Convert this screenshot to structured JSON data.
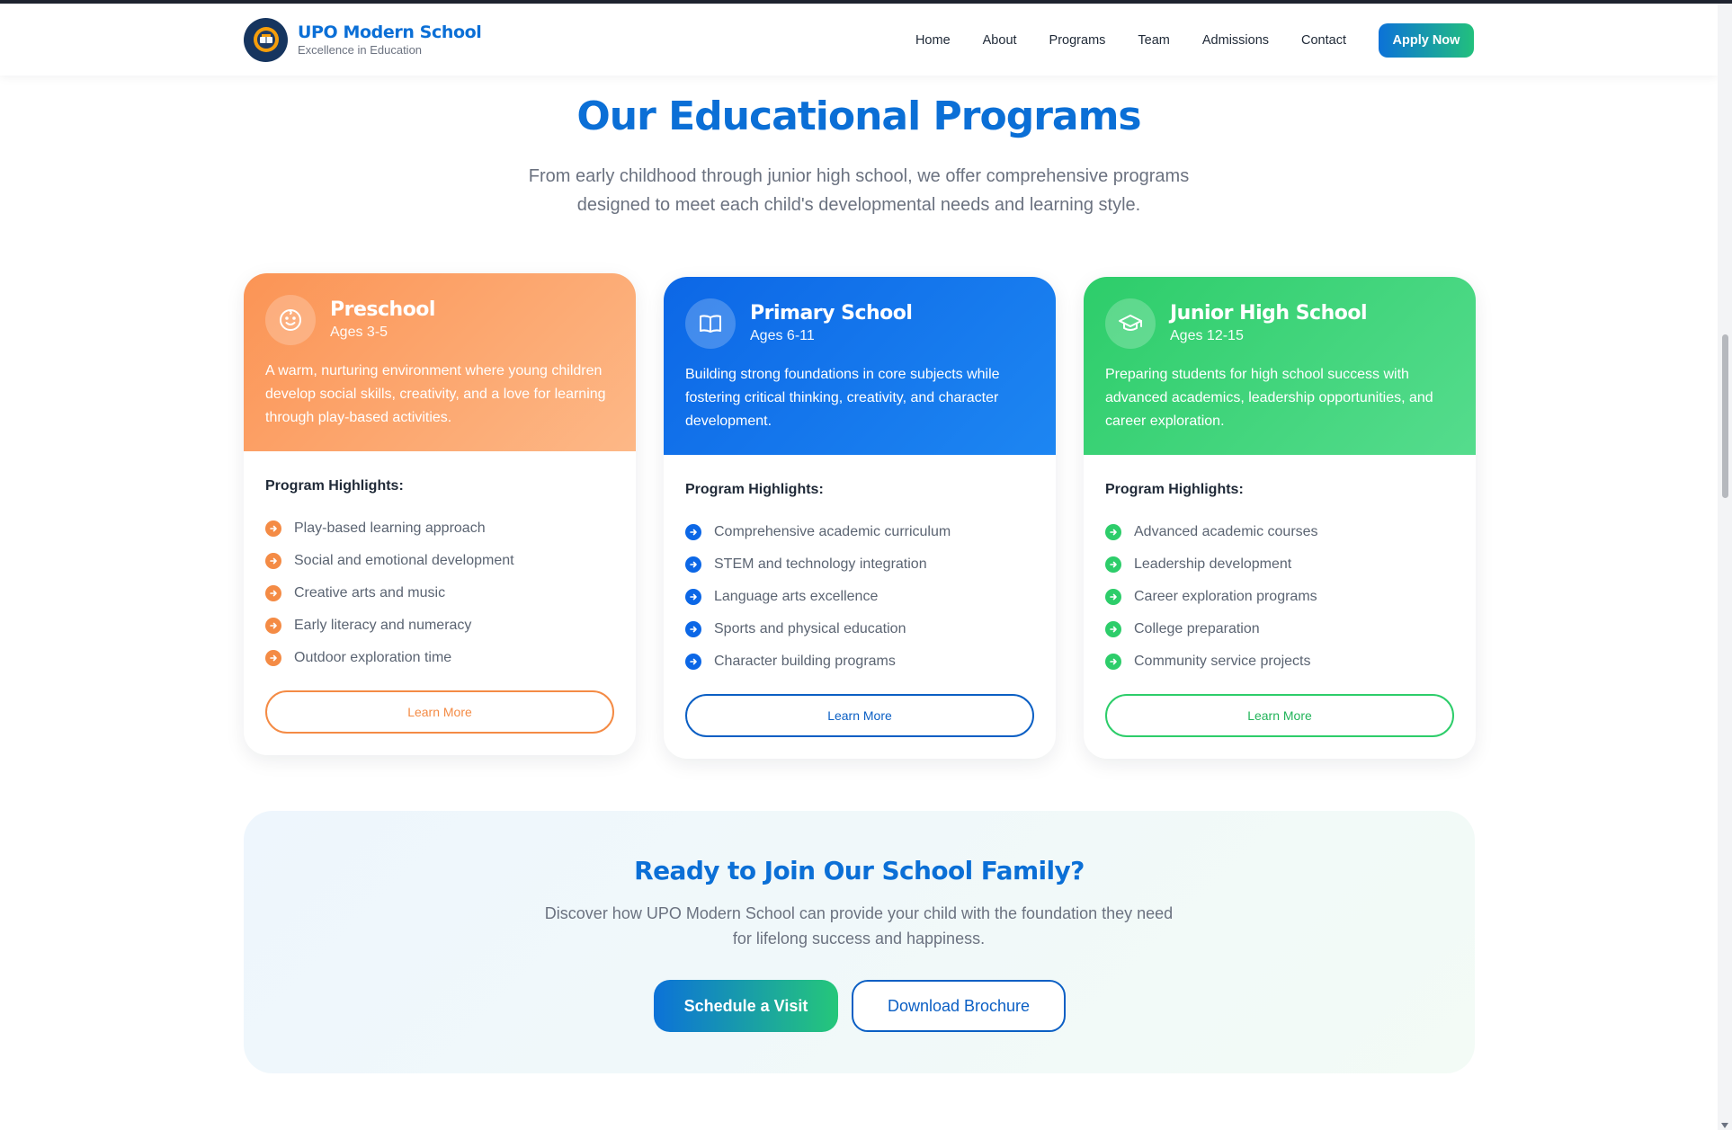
{
  "header": {
    "brand_name": "UPO Modern School",
    "brand_tagline": "Excellence in Education",
    "nav": [
      "Home",
      "About",
      "Programs",
      "Team",
      "Admissions",
      "Contact"
    ],
    "apply_label": "Apply Now"
  },
  "programs_section": {
    "title": "Our Educational Programs",
    "subtitle": "From early childhood through junior high school, we offer comprehensive programs designed to meet each child's developmental needs and learning style.",
    "highlights_label": "Program Highlights:",
    "cards": [
      {
        "title": "Preschool",
        "ages": "Ages 3-5",
        "icon": "smile-face-icon",
        "color": "#f48b45",
        "description": "A warm, nurturing environment where young children develop social skills, creativity, and a love for learning through play-based activities.",
        "highlights": [
          "Play-based learning approach",
          "Social and emotional development",
          "Creative arts and music",
          "Early literacy and numeracy",
          "Outdoor exploration time"
        ],
        "button": "Learn More"
      },
      {
        "title": "Primary School",
        "ages": "Ages 6-11",
        "icon": "open-book-icon",
        "color": "#0c67e6",
        "description": "Building strong foundations in core subjects while fostering critical thinking, creativity, and character development.",
        "highlights": [
          "Comprehensive academic curriculum",
          "STEM and technology integration",
          "Language arts excellence",
          "Sports and physical education",
          "Character building programs"
        ],
        "button": "Learn More"
      },
      {
        "title": "Junior High School",
        "ages": "Ages 12-15",
        "icon": "graduation-cap-icon",
        "color": "#2dcd6a",
        "description": "Preparing students for high school success with advanced academics, leadership opportunities, and career exploration.",
        "highlights": [
          "Advanced academic courses",
          "Leadership development",
          "Career exploration programs",
          "College preparation",
          "Community service projects"
        ],
        "button": "Learn More"
      }
    ]
  },
  "cta": {
    "title": "Ready to Join Our School Family?",
    "subtitle": "Discover how UPO Modern School can provide your child with the foundation they need for lifelong success and happiness.",
    "primary_button": "Schedule a Visit",
    "secondary_button": "Download Brochure"
  },
  "colors": {
    "brand_blue": "#0b6fd6",
    "orange": "#f48b45",
    "blue": "#0c67e6",
    "green": "#2dcd6a"
  }
}
